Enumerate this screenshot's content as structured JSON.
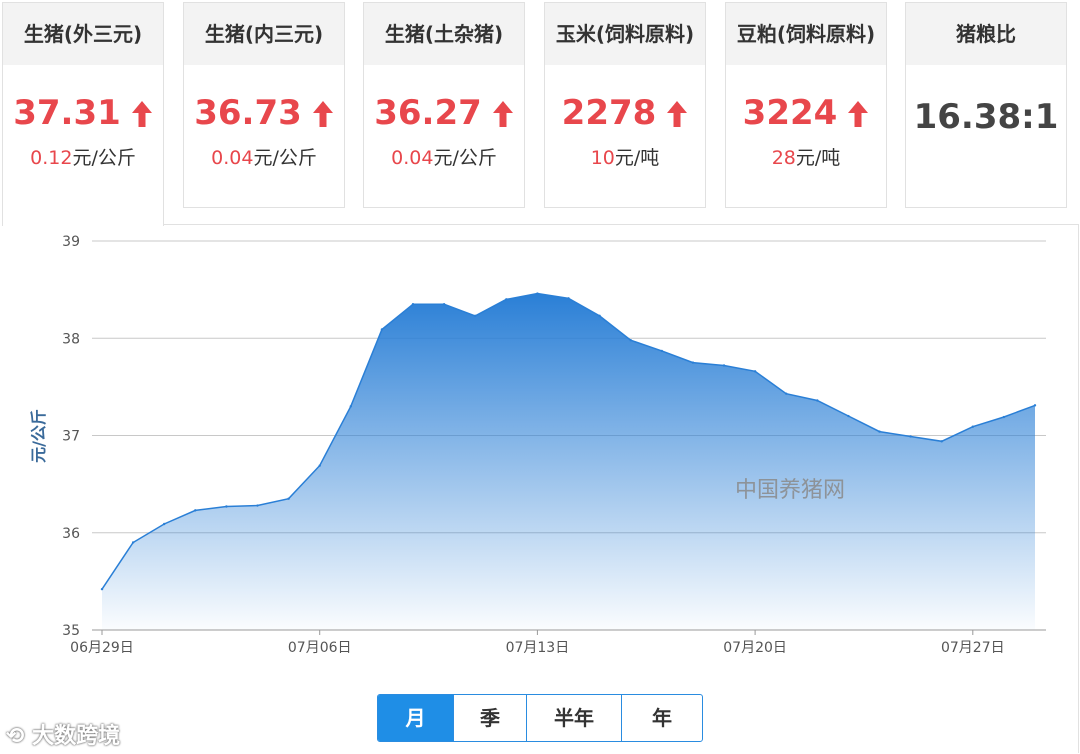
{
  "cards": [
    {
      "title": "生猪(外三元)",
      "price": "37.31",
      "change_value": "0.12",
      "change_unit": "元/公斤",
      "direction": "up",
      "active": true
    },
    {
      "title": "生猪(内三元)",
      "price": "36.73",
      "change_value": "0.04",
      "change_unit": "元/公斤",
      "direction": "up",
      "active": false
    },
    {
      "title": "生猪(土杂猪)",
      "price": "36.27",
      "change_value": "0.04",
      "change_unit": "元/公斤",
      "direction": "up",
      "active": false
    },
    {
      "title": "玉米(饲料原料)",
      "price": "2278",
      "change_value": "10",
      "change_unit": "元/吨",
      "direction": "up",
      "active": false
    },
    {
      "title": "豆粕(饲料原料)",
      "price": "3224",
      "change_value": "28",
      "change_unit": "元/吨",
      "direction": "up",
      "active": false
    },
    {
      "title": "猪粮比",
      "price": "16.38:1",
      "change_value": "",
      "change_unit": "",
      "direction": "none",
      "active": false
    }
  ],
  "chart_data": {
    "type": "area",
    "ylabel": "元/公斤",
    "watermark": "中国养猪网",
    "ylim": [
      35,
      39
    ],
    "yticks": [
      35,
      36,
      37,
      38,
      39
    ],
    "xticks": [
      "06月29日",
      "07月06日",
      "07月13日",
      "07月20日",
      "07月27日"
    ],
    "x": [
      "06-29",
      "06-30",
      "07-01",
      "07-02",
      "07-03",
      "07-04",
      "07-05",
      "07-06",
      "07-07",
      "07-08",
      "07-09",
      "07-10",
      "07-11",
      "07-12",
      "07-13",
      "07-14",
      "07-15",
      "07-16",
      "07-17",
      "07-18",
      "07-19",
      "07-20",
      "07-21",
      "07-22",
      "07-23",
      "07-24",
      "07-25",
      "07-26",
      "07-27",
      "07-28",
      "07-29"
    ],
    "series": [
      {
        "values": [
          35.42,
          35.9,
          36.09,
          36.23,
          36.27,
          36.28,
          36.35,
          36.69,
          37.3,
          38.09,
          38.35,
          38.35,
          38.23,
          38.4,
          38.46,
          38.41,
          38.23,
          37.98,
          37.87,
          37.75,
          37.72,
          37.66,
          37.43,
          37.36,
          37.2,
          37.04,
          36.99,
          36.94,
          37.09,
          37.19,
          37.31
        ],
        "color": "#2a7fd6"
      }
    ],
    "grid": true
  },
  "range_buttons": [
    "月",
    "季",
    "半年",
    "年"
  ],
  "active_range": "月",
  "logo_text": "大数跨境"
}
